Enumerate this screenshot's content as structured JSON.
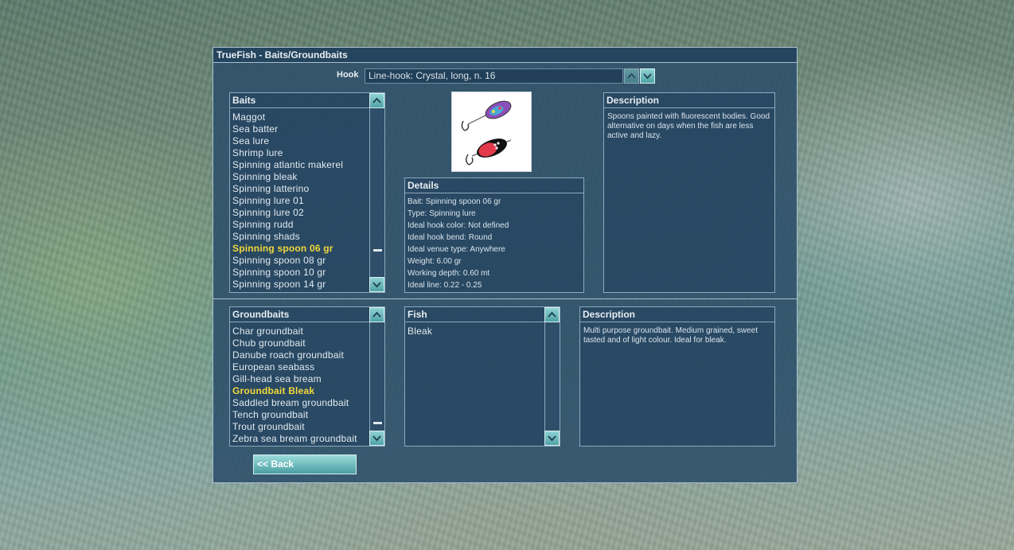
{
  "window": {
    "title": "TrueFish - Baits/Groundbaits"
  },
  "hook": {
    "label": "Hook",
    "value": "Line-hook: Crystal, long, n. 16"
  },
  "baits": {
    "title": "Baits",
    "items": [
      "Maggot",
      "Sea batter",
      "Sea lure",
      "Shrimp lure",
      "Spinning atlantic makerel",
      "Spinning bleak",
      "Spinning latterino",
      "Spinning lure 01",
      "Spinning lure 02",
      "Spinning rudd",
      "Spinning shads",
      "Spinning spoon 06 gr",
      "Spinning spoon 08 gr",
      "Spinning spoon 10 gr",
      "Spinning spoon 14 gr"
    ],
    "selected": "Spinning spoon 06 gr",
    "scroll_position": 0.85
  },
  "bait_description": {
    "title": "Description",
    "text": "Spoons painted with fluorescent bodies. Good alternative on days when the fish are less active and lazy."
  },
  "details": {
    "title": "Details",
    "lines": [
      "Bait: Spinning spoon 06 gr",
      "Type: Spinning lure",
      "Ideal hook color: Not defined",
      "Ideal hook bend: Round",
      "Ideal venue type: Anywhere",
      "Weight: 6.00 gr",
      "Working depth: 0.60 mt",
      "Ideal line: 0.22 - 0.25"
    ]
  },
  "groundbaits": {
    "title": "Groundbaits",
    "items": [
      "Char groundbait",
      "Chub groundbait",
      "Danube roach groundbait",
      "European seabass",
      "Gill-head sea bream",
      "Groundbait Bleak",
      "Saddled bream groundbait",
      "Tench groundbait",
      "Trout groundbait",
      "Zebra sea bream groundbait"
    ],
    "selected": "Groundbait Bleak",
    "scroll_position": 0.95
  },
  "fish": {
    "title": "Fish",
    "items": [
      "Bleak"
    ]
  },
  "groundbait_description": {
    "title": "Description",
    "text": "Multi purpose groundbait. Medium grained, sweet tasted and of light colour. Ideal for bleak."
  },
  "buttons": {
    "back": "<< Back"
  },
  "icons": {
    "scroll_up": "chevron-up-icon",
    "scroll_down": "chevron-down-icon",
    "bait_image": "spinning-spoon-image"
  },
  "colors": {
    "panel_bg": "#2c4e6a",
    "border": "#a9c0cf",
    "button": "#6bbcbf",
    "selected_text": "#f2d83a"
  }
}
